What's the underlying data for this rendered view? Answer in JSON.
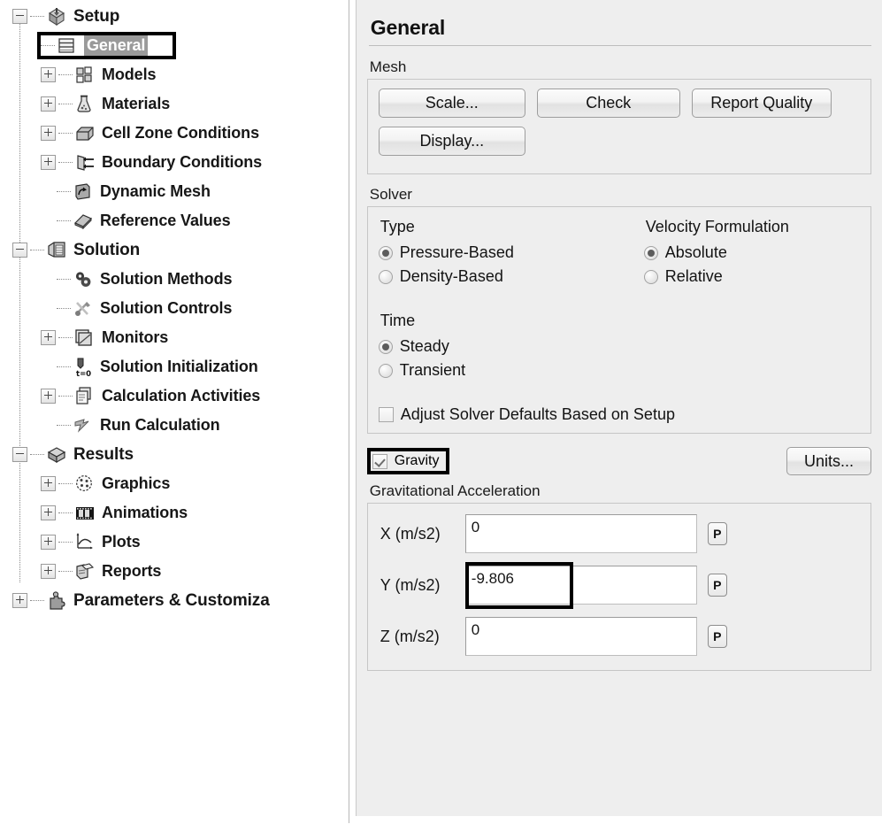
{
  "tree": {
    "items": [
      {
        "label": "Setup",
        "level": 0,
        "expander": "minus",
        "icon": "setup-box-icon",
        "selected": false
      },
      {
        "label": "General",
        "level": 1,
        "expander": "none",
        "icon": "general-list-icon",
        "selected": true,
        "annotated": true
      },
      {
        "label": "Models",
        "level": 1,
        "expander": "plus",
        "icon": "models-grid-icon",
        "selected": false
      },
      {
        "label": "Materials",
        "level": 1,
        "expander": "plus",
        "icon": "materials-flask-icon",
        "selected": false
      },
      {
        "label": "Cell Zone Conditions",
        "level": 1,
        "expander": "plus",
        "icon": "cell-zone-box-icon",
        "selected": false
      },
      {
        "label": "Boundary Conditions",
        "level": 1,
        "expander": "plus",
        "icon": "boundary-arrows-icon",
        "selected": false
      },
      {
        "label": "Dynamic Mesh",
        "level": 1,
        "expander": "none",
        "icon": "dynamic-mesh-icon",
        "selected": false
      },
      {
        "label": "Reference Values",
        "level": 1,
        "expander": "none",
        "icon": "reference-values-book-icon",
        "selected": false
      },
      {
        "label": "Solution",
        "level": 0,
        "expander": "minus",
        "icon": "solution-stack-icon",
        "selected": false
      },
      {
        "label": "Solution Methods",
        "level": 1,
        "expander": "none",
        "icon": "solution-methods-gears-icon",
        "selected": false
      },
      {
        "label": "Solution Controls",
        "level": 1,
        "expander": "none",
        "icon": "solution-controls-tools-icon",
        "selected": false
      },
      {
        "label": "Monitors",
        "level": 1,
        "expander": "plus",
        "icon": "monitors-chart-icon",
        "selected": false
      },
      {
        "label": "Solution Initialization",
        "level": 1,
        "expander": "none",
        "icon": "solution-initialization-icon",
        "selected": false
      },
      {
        "label": "Calculation Activities",
        "level": 1,
        "expander": "plus",
        "icon": "calculation-activities-icon",
        "selected": false
      },
      {
        "label": "Run Calculation",
        "level": 1,
        "expander": "none",
        "icon": "run-calculation-icon",
        "selected": false
      },
      {
        "label": "Results",
        "level": 0,
        "expander": "minus",
        "icon": "results-box-icon",
        "selected": false
      },
      {
        "label": "Graphics",
        "level": 1,
        "expander": "plus",
        "icon": "graphics-palette-icon",
        "selected": false
      },
      {
        "label": "Animations",
        "level": 1,
        "expander": "plus",
        "icon": "animations-filmstrip-icon",
        "selected": false
      },
      {
        "label": "Plots",
        "level": 1,
        "expander": "plus",
        "icon": "plots-graph-icon",
        "selected": false
      },
      {
        "label": "Reports",
        "level": 1,
        "expander": "plus",
        "icon": "reports-pages-icon",
        "selected": false
      },
      {
        "label": "Parameters & Customiza",
        "level": 0,
        "expander": "plus",
        "icon": "parameters-puzzle-icon",
        "selected": false
      }
    ]
  },
  "panel": {
    "title": "General",
    "mesh": {
      "label": "Mesh",
      "scale_label": "Scale...",
      "check_label": "Check",
      "report_quality_label": "Report Quality",
      "display_label": "Display..."
    },
    "solver": {
      "label": "Solver",
      "type_label": "Type",
      "type_options": [
        "Pressure-Based",
        "Density-Based"
      ],
      "type_selected": "Pressure-Based",
      "velocity_label": "Velocity Formulation",
      "velocity_options": [
        "Absolute",
        "Relative"
      ],
      "velocity_selected": "Absolute",
      "time_label": "Time",
      "time_options": [
        "Steady",
        "Transient"
      ],
      "time_selected": "Steady",
      "adjust_defaults_label": "Adjust Solver Defaults Based on Setup",
      "adjust_defaults_checked": false
    },
    "gravity": {
      "label": "Gravity",
      "checked": true,
      "units_label": "Units...",
      "acceleration_label": "Gravitational Acceleration",
      "fields": [
        {
          "label": "X (m/s2)",
          "value": "0",
          "param_button": "P",
          "highlighted": false
        },
        {
          "label": "Y (m/s2)",
          "value": "-9.806",
          "param_button": "P",
          "highlighted": true
        },
        {
          "label": "Z (m/s2)",
          "value": "0",
          "param_button": "P",
          "highlighted": false
        }
      ]
    }
  }
}
